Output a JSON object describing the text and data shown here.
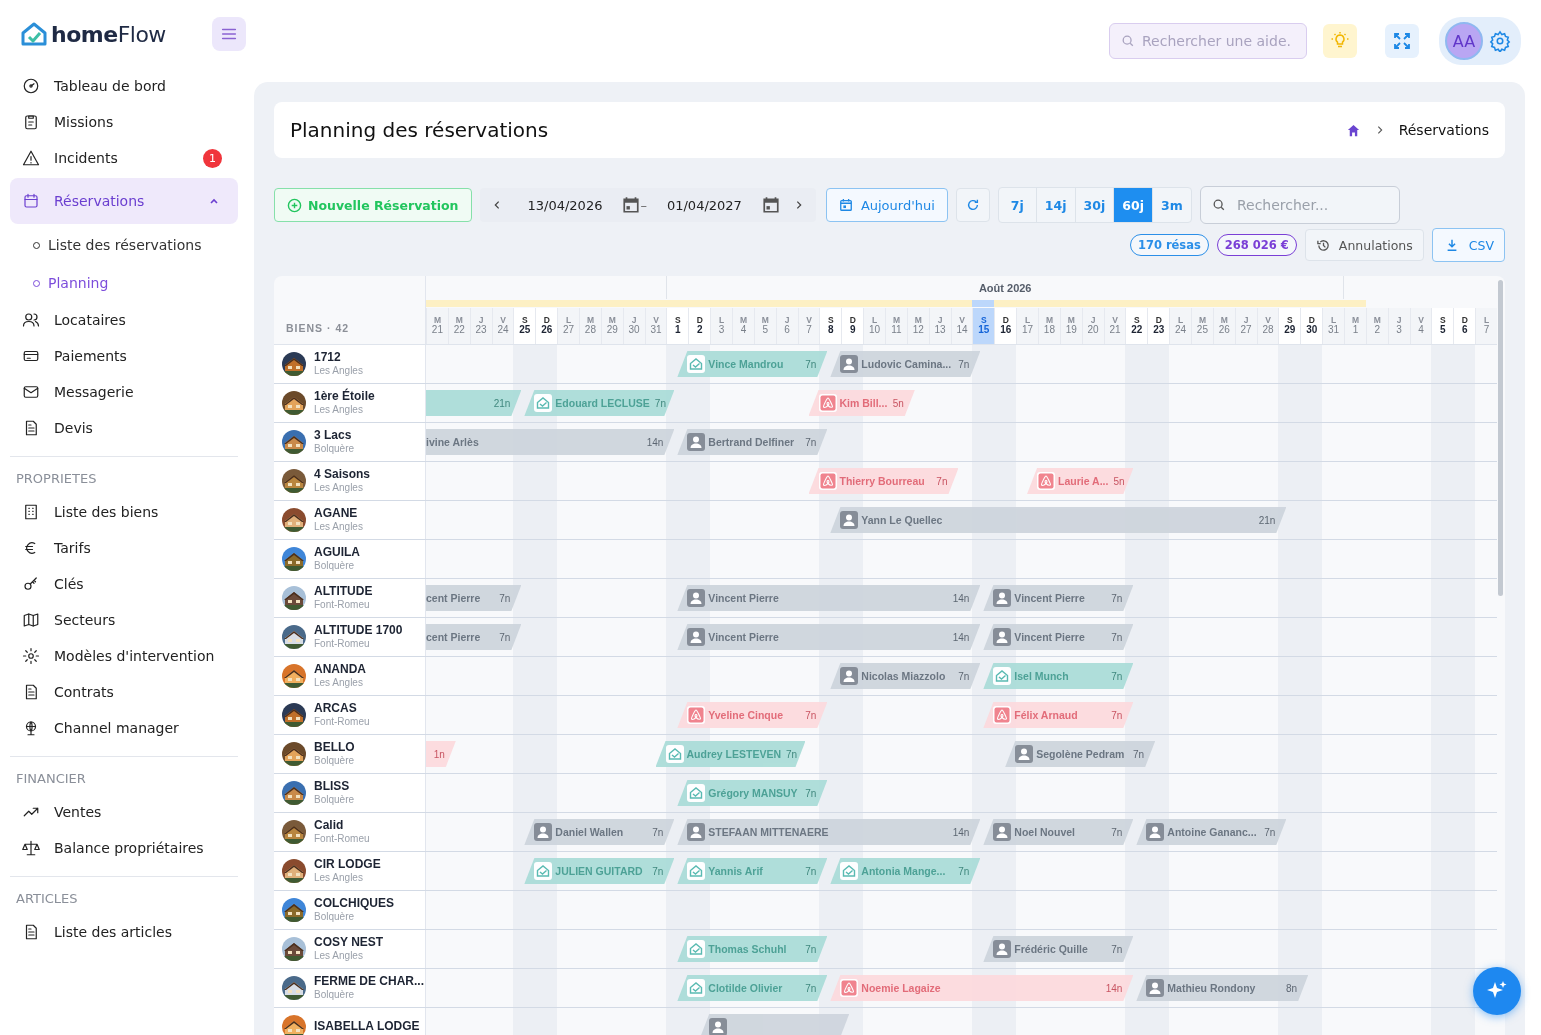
{
  "brand": "**home**Flow",
  "sidebar": {
    "groups": [
      {
        "items": [
          {
            "label": "Tableau de bord",
            "selected": false
          },
          {
            "label": "Missions",
            "selected": false
          },
          {
            "label": "Incidents",
            "selected": false,
            "badge": "1"
          },
          {
            "label": "Réservations",
            "selected": true,
            "expanded": true,
            "children": [
              {
                "label": "Liste des réservations",
                "selected": false
              },
              {
                "label": "Planning",
                "selected": true
              }
            ]
          },
          {
            "label": "Locataires",
            "selected": false
          },
          {
            "label": "Paiements",
            "selected": false
          },
          {
            "label": "Messagerie",
            "selected": false
          },
          {
            "label": "Devis",
            "selected": false
          }
        ]
      },
      {
        "heading": "PROPRIETES",
        "items": [
          {
            "label": "Liste des biens",
            "selected": false
          },
          {
            "label": "Tarifs",
            "selected": false
          },
          {
            "label": "Clés",
            "selected": false
          },
          {
            "label": "Secteurs",
            "selected": false
          },
          {
            "label": "Modèles d'intervention",
            "selected": false
          },
          {
            "label": "Contrats",
            "selected": false
          },
          {
            "label": "Channel manager",
            "selected": false
          }
        ]
      },
      {
        "heading": "FINANCIER",
        "items": [
          {
            "label": "Ventes",
            "selected": false
          },
          {
            "label": "Balance propriétaires",
            "selected": false
          }
        ]
      },
      {
        "heading": "ARTICLES",
        "items": [
          {
            "label": "Liste des articles",
            "selected": false
          }
        ]
      }
    ]
  },
  "topbar": {
    "search_placeholder": "Rechercher une aide.",
    "avatar": "AA"
  },
  "page": {
    "title": "Planning des réservations",
    "breadcrumb": "Réservations"
  },
  "toolbar": {
    "new_button": "Nouvelle Réservation",
    "date_from": "13/04/2026",
    "date_separator": "–",
    "date_to": "01/04/2027",
    "today_button": "Aujourd'hui",
    "ranges": [
      {
        "label": "7j",
        "selected": false
      },
      {
        "label": "14j",
        "selected": false
      },
      {
        "label": "30j",
        "selected": false
      },
      {
        "label": "60j",
        "selected": true
      },
      {
        "label": "3m",
        "selected": false
      }
    ],
    "search_placeholder": "Rechercher...",
    "count_badge": "170 résas",
    "amount_badge": "268 026 €",
    "cancellations_button": "Annulations",
    "export_button": "CSV"
  },
  "planning": {
    "properties_label": "BIENS · 42",
    "months": [
      {
        "label": "Août 2026"
      }
    ],
    "days": [
      {
        "weekday": "M",
        "day": "21",
        "weekend": false,
        "today": false
      },
      {
        "weekday": "M",
        "day": "22",
        "weekend": false,
        "today": false
      },
      {
        "weekday": "J",
        "day": "23",
        "weekend": false,
        "today": false
      },
      {
        "weekday": "V",
        "day": "24",
        "weekend": false,
        "today": false
      },
      {
        "weekday": "S",
        "day": "25",
        "weekend": true,
        "today": false
      },
      {
        "weekday": "D",
        "day": "26",
        "weekend": true,
        "today": false
      },
      {
        "weekday": "L",
        "day": "27",
        "weekend": false,
        "today": false
      },
      {
        "weekday": "M",
        "day": "28",
        "weekend": false,
        "today": false
      },
      {
        "weekday": "M",
        "day": "29",
        "weekend": false,
        "today": false
      },
      {
        "weekday": "J",
        "day": "30",
        "weekend": false,
        "today": false
      },
      {
        "weekday": "V",
        "day": "31",
        "weekend": false,
        "today": false
      },
      {
        "weekday": "S",
        "day": "1",
        "weekend": true,
        "today": false
      },
      {
        "weekday": "D",
        "day": "2",
        "weekend": true,
        "today": false
      },
      {
        "weekday": "L",
        "day": "3",
        "weekend": false,
        "today": false
      },
      {
        "weekday": "M",
        "day": "4",
        "weekend": false,
        "today": false
      },
      {
        "weekday": "M",
        "day": "5",
        "weekend": false,
        "today": false
      },
      {
        "weekday": "J",
        "day": "6",
        "weekend": false,
        "today": false
      },
      {
        "weekday": "V",
        "day": "7",
        "weekend": false,
        "today": false
      },
      {
        "weekday": "S",
        "day": "8",
        "weekend": true,
        "today": false
      },
      {
        "weekday": "D",
        "day": "9",
        "weekend": true,
        "today": false
      },
      {
        "weekday": "L",
        "day": "10",
        "weekend": false,
        "today": false
      },
      {
        "weekday": "M",
        "day": "11",
        "weekend": false,
        "today": false
      },
      {
        "weekday": "M",
        "day": "12",
        "weekend": false,
        "today": false
      },
      {
        "weekday": "J",
        "day": "13",
        "weekend": false,
        "today": false
      },
      {
        "weekday": "V",
        "day": "14",
        "weekend": false,
        "today": false
      },
      {
        "weekday": "S",
        "day": "15",
        "weekend": true,
        "today": true
      },
      {
        "weekday": "D",
        "day": "16",
        "weekend": true,
        "today": false
      },
      {
        "weekday": "L",
        "day": "17",
        "weekend": false,
        "today": false
      },
      {
        "weekday": "M",
        "day": "18",
        "weekend": false,
        "today": false
      },
      {
        "weekday": "M",
        "day": "19",
        "weekend": false,
        "today": false
      },
      {
        "weekday": "J",
        "day": "20",
        "weekend": false,
        "today": false
      },
      {
        "weekday": "V",
        "day": "21",
        "weekend": false,
        "today": false
      },
      {
        "weekday": "S",
        "day": "22",
        "weekend": true,
        "today": false
      },
      {
        "weekday": "D",
        "day": "23",
        "weekend": true,
        "today": false
      },
      {
        "weekday": "L",
        "day": "24",
        "weekend": false,
        "today": false
      },
      {
        "weekday": "M",
        "day": "25",
        "weekend": false,
        "today": false
      },
      {
        "weekday": "M",
        "day": "26",
        "weekend": false,
        "today": false
      },
      {
        "weekday": "J",
        "day": "27",
        "weekend": false,
        "today": false
      },
      {
        "weekday": "V",
        "day": "28",
        "weekend": false,
        "today": false
      },
      {
        "weekday": "S",
        "day": "29",
        "weekend": true,
        "today": false
      },
      {
        "weekday": "D",
        "day": "30",
        "weekend": true,
        "today": false
      },
      {
        "weekday": "L",
        "day": "31",
        "weekend": false,
        "today": false
      },
      {
        "weekday": "M",
        "day": "1",
        "weekend": false,
        "today": false
      },
      {
        "weekday": "M",
        "day": "2",
        "weekend": false,
        "today": false
      },
      {
        "weekday": "J",
        "day": "3",
        "weekend": false,
        "today": false
      },
      {
        "weekday": "V",
        "day": "4",
        "weekend": false,
        "today": false
      },
      {
        "weekday": "S",
        "day": "5",
        "weekend": true,
        "today": false
      },
      {
        "weekday": "D",
        "day": "6",
        "weekend": true,
        "today": false
      },
      {
        "weekday": "L",
        "day": "7",
        "weekend": false,
        "today": false
      }
    ],
    "properties": [
      {
        "name": "1712",
        "location": "Les Angles",
        "bookings": [
          {
            "kind": "direct",
            "guest": "Vince Mandrou",
            "nights": "7n"
          },
          {
            "kind": "owner",
            "guest": "Ludovic Camina...",
            "nights": "7n"
          }
        ]
      },
      {
        "name": "1ère Étoile",
        "location": "Les Angles",
        "bookings": [
          {
            "kind": "direct",
            "nights": "21n"
          },
          {
            "kind": "direct",
            "guest": "Edouard LECLUSE",
            "nights": "7n"
          },
          {
            "kind": "airbnb",
            "guest": "Kim Bill...",
            "nights": "5n"
          }
        ]
      },
      {
        "name": "3 Lacs",
        "location": "Bolquère",
        "bookings": [
          {
            "kind": "owner",
            "guest": "ivine Arlès",
            "nights": "14n"
          },
          {
            "kind": "owner",
            "guest": "Bertrand Delfiner",
            "nights": "7n"
          }
        ]
      },
      {
        "name": "4 Saisons",
        "location": "Les Angles",
        "bookings": [
          {
            "kind": "airbnb",
            "guest": "Thierry Bourreau",
            "nights": "7n"
          },
          {
            "kind": "airbnb",
            "guest": "Laurie A...",
            "nights": "5n"
          }
        ]
      },
      {
        "name": "AGANE",
        "location": "Les Angles",
        "bookings": [
          {
            "kind": "owner",
            "guest": "Yann Le Quellec",
            "nights": "21n"
          }
        ]
      },
      {
        "name": "AGUILA",
        "location": "Bolquère"
      },
      {
        "name": "ALTITUDE",
        "location": "Font-Romeu",
        "bookings": [
          {
            "kind": "owner",
            "guest": "cent Pierre",
            "nights": "7n"
          },
          {
            "kind": "owner",
            "guest": "Vincent Pierre",
            "nights": "14n"
          },
          {
            "kind": "owner",
            "guest": "Vincent Pierre",
            "nights": "7n"
          }
        ]
      },
      {
        "name": "ALTITUDE 1700",
        "location": "Font-Romeu",
        "bookings": [
          {
            "kind": "owner",
            "guest": "cent Pierre",
            "nights": "7n"
          },
          {
            "kind": "owner",
            "guest": "Vincent Pierre",
            "nights": "14n"
          },
          {
            "kind": "owner",
            "guest": "Vincent Pierre",
            "nights": "7n"
          }
        ]
      },
      {
        "name": "ANANDA",
        "location": "Les Angles",
        "bookings": [
          {
            "kind": "owner",
            "guest": "Nicolas Miazzolo",
            "nights": "7n"
          },
          {
            "kind": "direct",
            "guest": "Isel Munch",
            "nights": "7n"
          }
        ]
      },
      {
        "name": "ARCAS",
        "location": "Font-Romeu",
        "bookings": [
          {
            "kind": "airbnb",
            "guest": "Yveline Cinque",
            "nights": "7n"
          },
          {
            "kind": "airbnb",
            "guest": "Félix Arnaud",
            "nights": "7n"
          }
        ]
      },
      {
        "name": "BELLO",
        "location": "Bolquère",
        "bookings": [
          {
            "kind": "airbnb",
            "nights": "1n"
          },
          {
            "kind": "direct",
            "guest": "Audrey LESTEVEN",
            "nights": "7n"
          },
          {
            "kind": "owner",
            "guest": "Segolène Pedram",
            "nights": "7n"
          }
        ]
      },
      {
        "name": "BLISS",
        "location": "Bolquère",
        "bookings": [
          {
            "kind": "direct",
            "guest": "Grégory MANSUY",
            "nights": "7n"
          }
        ]
      },
      {
        "name": "Calid",
        "location": "Font-Romeu",
        "bookings": [
          {
            "kind": "owner",
            "guest": "Daniel Wallen",
            "nights": "7n"
          },
          {
            "kind": "owner",
            "guest": "STEFAAN MITTENAERE",
            "nights": "14n"
          },
          {
            "kind": "owner",
            "guest": "Noel Nouvel",
            "nights": "7n"
          },
          {
            "kind": "owner",
            "guest": "Antoine Gananc...",
            "nights": "7n"
          }
        ]
      },
      {
        "name": "CIR LODGE",
        "location": "Les Angles",
        "bookings": [
          {
            "kind": "direct",
            "guest": "JULIEN GUITARD",
            "nights": "7n"
          },
          {
            "kind": "direct",
            "guest": "Yannis Arif",
            "nights": "7n"
          },
          {
            "kind": "direct",
            "guest": "Antonia Mange...",
            "nights": "7n"
          }
        ]
      },
      {
        "name": "COLCHIQUES",
        "location": "Bolquère"
      },
      {
        "name": "COSY NEST",
        "location": "Les Angles",
        "bookings": [
          {
            "kind": "direct",
            "guest": "Thomas Schuhl",
            "nights": "7n"
          },
          {
            "kind": "owner",
            "guest": "Frédéric Quille",
            "nights": "7n"
          }
        ]
      },
      {
        "name": "FERME DE CHAR...",
        "location": "Bolquère",
        "bookings": [
          {
            "kind": "direct",
            "guest": "Clotilde Olivier",
            "nights": "7n"
          },
          {
            "kind": "airbnb",
            "guest": "Noemie Lagaize",
            "nights": "14n"
          },
          {
            "kind": "owner",
            "guest": "Mathieu Rondony",
            "nights": "8n"
          }
        ]
      },
      {
        "name": "ISABELLA LODGE",
        "bookings": [
          {
            "kind": "owner"
          }
        ]
      }
    ]
  }
}
